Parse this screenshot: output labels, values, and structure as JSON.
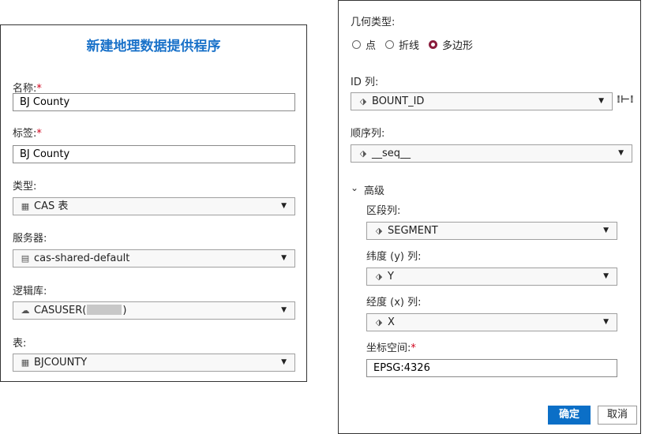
{
  "left": {
    "title": "新建地理数据提供程序",
    "name": {
      "label": "名称:",
      "required": "*",
      "value": "BJ County"
    },
    "tag": {
      "label": "标签:",
      "required": "*",
      "value": "BJ County"
    },
    "type": {
      "label": "类型:",
      "value": "CAS 表",
      "icon": "table-icon"
    },
    "server": {
      "label": "服务器:",
      "value": "cas-shared-default",
      "icon": "server-icon"
    },
    "caslib": {
      "label": "逻辑库:",
      "value_prefix": "CASUSER(",
      "value_suffix": ")",
      "icon": "caslib-icon"
    },
    "table": {
      "label": "表:",
      "value": "BJCOUNTY",
      "icon": "table-icon"
    }
  },
  "right": {
    "geometry": {
      "label": "几何类型:",
      "options": [
        "点",
        "折线",
        "多边形"
      ],
      "selected": "多边形"
    },
    "id_col": {
      "label": "ID 列:",
      "value": "BOUNT_ID",
      "icon": "column-icon"
    },
    "seq_col": {
      "label": "顺序列:",
      "value": "__seq__",
      "icon": "column-icon"
    },
    "advanced": {
      "label": "高级",
      "segment": {
        "label": "区段列:",
        "value": "SEGMENT",
        "icon": "column-icon"
      },
      "lat": {
        "label": "纬度 (y) 列:",
        "value": "Y",
        "icon": "column-icon"
      },
      "lon": {
        "label": "经度 (x) 列:",
        "value": "X",
        "icon": "column-icon"
      },
      "coord": {
        "label": "坐标空间:",
        "required": "*",
        "value": "EPSG:4326"
      }
    },
    "buttons": {
      "ok": "确定",
      "cancel": "取消"
    }
  },
  "colors": {
    "accent": "#1a72c9",
    "primary_button": "#0b6fc7",
    "required": "#d0021b",
    "radio_selected": "#8a1c3c"
  }
}
